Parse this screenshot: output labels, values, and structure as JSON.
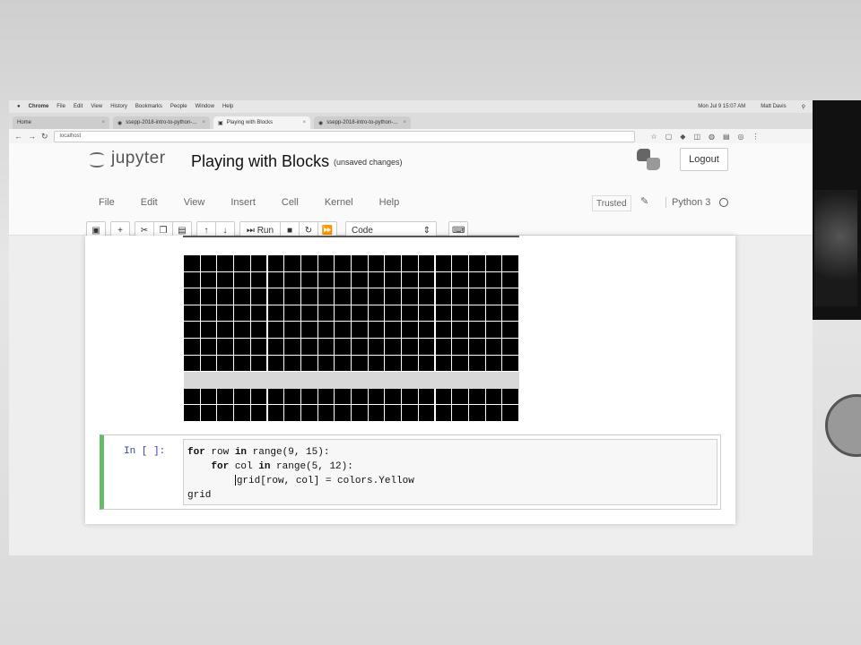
{
  "mac_menu": {
    "items": [
      "Chrome",
      "File",
      "Edit",
      "View",
      "History",
      "Bookmarks",
      "People",
      "Window",
      "Help"
    ],
    "clock": "Mon Jul 9  15:07 AM",
    "user": "Matt Davis"
  },
  "browser": {
    "tabs": [
      {
        "label": "Home",
        "active": false
      },
      {
        "label": "ssepp-2018-intro-to-python-...",
        "active": false
      },
      {
        "label": "Playing with Blocks",
        "active": true
      },
      {
        "label": "ssepp-2018-intro-to-python-...",
        "active": false
      }
    ],
    "url": "localhost"
  },
  "jupyter": {
    "logo_text": "jupyter",
    "notebook_title": "Playing with Blocks",
    "save_status": "(unsaved changes)",
    "logout_label": "Logout",
    "menus": [
      "File",
      "Edit",
      "View",
      "Insert",
      "Cell",
      "Kernel",
      "Help"
    ],
    "trusted_label": "Trusted",
    "kernel_name": "Python 3",
    "toolbar": {
      "run_label": "Run",
      "cell_type": "Code"
    }
  },
  "output_grid": {
    "rows": 10,
    "cols": 20,
    "cell_color": "#000000",
    "blank_row_index": 7,
    "blank_row_color": "#d8d8d8"
  },
  "code_cell": {
    "prompt": "In [ ]:",
    "lines": [
      "for row in range(9, 15):",
      "    for col in range(5, 12):",
      "        grid[row, col] = colors.Yellow",
      "grid"
    ]
  }
}
